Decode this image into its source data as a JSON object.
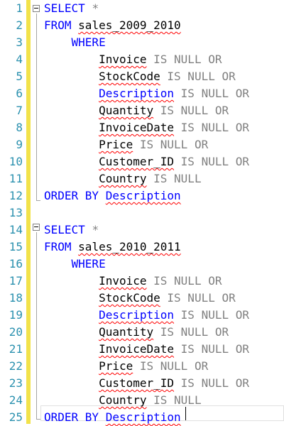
{
  "editor": {
    "line_numbers": [
      "1",
      "2",
      "3",
      "4",
      "5",
      "6",
      "7",
      "8",
      "9",
      "10",
      "11",
      "12",
      "13",
      "14",
      "15",
      "16",
      "17",
      "18",
      "19",
      "20",
      "21",
      "22",
      "23",
      "24",
      "25"
    ],
    "block1": {
      "select_kw": "SELECT",
      "star": "*",
      "from_kw": "FROM",
      "table": "sales_2009_2010",
      "where_kw": "WHERE",
      "conditions": [
        {
          "col": "Invoice",
          "op": "IS NULL OR",
          "is_keyword_col": false
        },
        {
          "col": "StockCode",
          "op": "IS NULL OR",
          "is_keyword_col": false
        },
        {
          "col": "Description",
          "op": "IS NULL OR",
          "is_keyword_col": true
        },
        {
          "col": "Quantity",
          "op": "IS NULL OR",
          "is_keyword_col": false
        },
        {
          "col": "InvoiceDate",
          "op": "IS NULL OR",
          "is_keyword_col": false
        },
        {
          "col": "Price",
          "op": "IS NULL OR",
          "is_keyword_col": false
        },
        {
          "col": "Customer_ID",
          "op": "IS NULL OR",
          "is_keyword_col": false
        },
        {
          "col": "Country",
          "op": "IS NULL",
          "is_keyword_col": false
        }
      ],
      "order_kw": "ORDER BY",
      "order_col": "Description"
    },
    "block2": {
      "select_kw": "SELECT",
      "star": "*",
      "from_kw": "FROM",
      "table": "sales_2010_2011",
      "where_kw": "WHERE",
      "conditions": [
        {
          "col": "Invoice",
          "op": "IS NULL OR",
          "is_keyword_col": false
        },
        {
          "col": "StockCode",
          "op": "IS NULL OR",
          "is_keyword_col": false
        },
        {
          "col": "Description",
          "op": "IS NULL OR",
          "is_keyword_col": true
        },
        {
          "col": "Quantity",
          "op": "IS NULL OR",
          "is_keyword_col": false
        },
        {
          "col": "InvoiceDate",
          "op": "IS NULL OR",
          "is_keyword_col": false
        },
        {
          "col": "Price",
          "op": "IS NULL OR",
          "is_keyword_col": false
        },
        {
          "col": "Customer_ID",
          "op": "IS NULL OR",
          "is_keyword_col": false
        },
        {
          "col": "Country",
          "op": "IS NULL",
          "is_keyword_col": false
        }
      ],
      "order_kw": "ORDER BY",
      "order_col": "Description"
    },
    "colors": {
      "keyword": "#0000ff",
      "operator": "#808080",
      "identifier": "#000000",
      "line_number": "#2b91af",
      "change_marker": "#f2e24a",
      "squiggle": "#ff0000"
    }
  }
}
